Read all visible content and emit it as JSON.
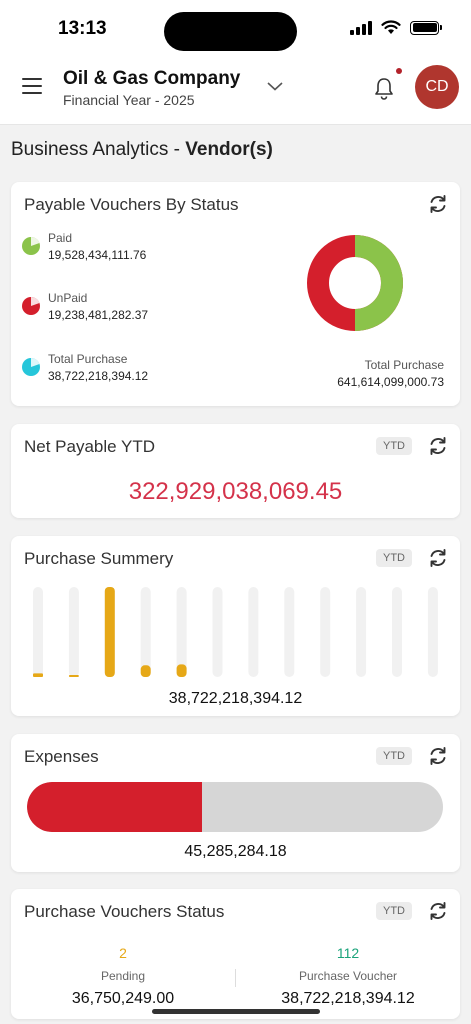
{
  "status_bar": {
    "time": "13:13"
  },
  "header": {
    "company_name": "Oil & Gas Company",
    "financial_year": "Financial Year - 2025",
    "avatar_initials": "CD"
  },
  "page_title": {
    "prefix": "Business Analytics - ",
    "emphasis": "Vendor(s)"
  },
  "payable_vouchers": {
    "title": "Payable Vouchers By Status",
    "legend": [
      {
        "label": "Paid",
        "value": "19,528,434,111.76",
        "color": "#8bc34a"
      },
      {
        "label": "UnPaid",
        "value": "19,238,481,282.37",
        "color": "#d41f2c"
      },
      {
        "label": "Total Purchase",
        "value": "38,722,218,394.12",
        "color": "#26c6da"
      }
    ],
    "total_label": "Total Purchase",
    "total_value": "641,614,099,000.73"
  },
  "net_payable": {
    "title": "Net Payable YTD",
    "badge": "YTD",
    "value": "322,929,038,069.45"
  },
  "purchase_summary": {
    "title": "Purchase Summery",
    "badge": "YTD",
    "total": "38,722,218,394.12",
    "bar_levels": [
      0.04,
      0.01,
      1.0,
      0.13,
      0.14,
      0,
      0,
      0,
      0,
      0,
      0,
      0
    ]
  },
  "expenses": {
    "title": "Expenses",
    "badge": "YTD",
    "value": "45,285,284.18",
    "fill_fraction": 0.42
  },
  "purchase_vouchers_status": {
    "title": "Purchase Vouchers Status",
    "badge": "YTD",
    "pending": {
      "count": "2",
      "label": "Pending",
      "value": "36,750,249.00",
      "color": "#e6a817"
    },
    "voucher": {
      "count": "112",
      "label": "Purchase Voucher",
      "value": "38,722,218,394.12",
      "color": "#1aa37a"
    }
  },
  "colors": {
    "accent_red": "#d41f2c",
    "paid_green": "#8bc34a",
    "bar_gold": "#e6a817"
  }
}
